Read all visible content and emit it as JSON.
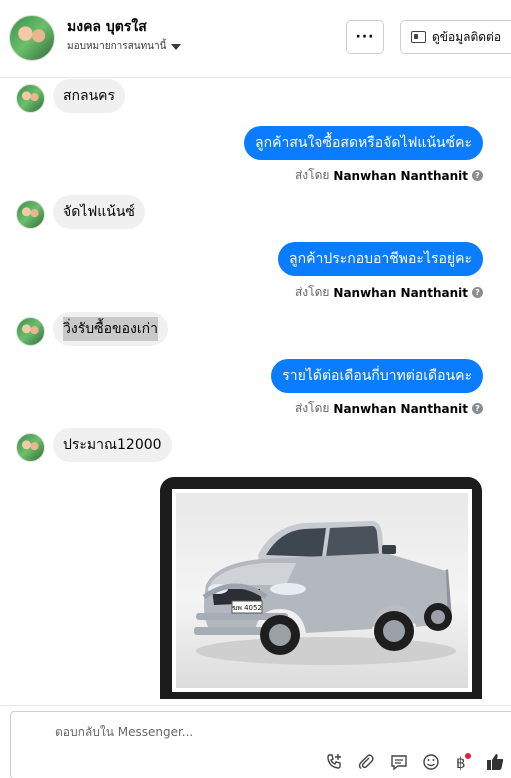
{
  "header": {
    "name": "มงคล บุตรใส",
    "assign_label": "มอบหมายการสนทนานี้",
    "more_label": "···",
    "contact_label": "ดูข้อมูลติดต่อ"
  },
  "messages": [
    {
      "type": "in",
      "text": "สกลนคร"
    },
    {
      "type": "out",
      "text": "ลูกค้าสนใจซื้อสดหรือจัดไฟแน้นซ์คะ",
      "sent_by_prefix": "ส่งโดย",
      "sent_by_name": "Nanwhan Nanthanit"
    },
    {
      "type": "in",
      "text": "จัดไฟแน้นซ์"
    },
    {
      "type": "out",
      "text": "ลูกค้าประกอบอาชีพอะไรอยู่คะ",
      "sent_by_prefix": "ส่งโดย",
      "sent_by_name": "Nanwhan Nanthanit"
    },
    {
      "type": "in",
      "text": "วิ่งรับซื้อของเก่า"
    },
    {
      "type": "out",
      "text": "รายได้ต่อเดือนกี่บาทต่อเดือนคะ",
      "sent_by_prefix": "ส่งโดย",
      "sent_by_name": "Nanwhan Nanthanit"
    },
    {
      "type": "in",
      "text": "ประมาณ12000"
    }
  ],
  "image_card": {
    "plate_text": "ฆพ 4052"
  },
  "composer": {
    "placeholder": "ตอบกลับใน Messenger..."
  },
  "icons": {
    "more": "more-dots-icon",
    "contact": "contact-card-icon",
    "info": "info-icon",
    "tools": [
      "add-call-icon",
      "attach-icon",
      "saved-reply-icon",
      "emoji-icon",
      "payment-icon",
      "like-icon"
    ]
  },
  "colors": {
    "outgoing_bubble": "#0a7cff",
    "incoming_bubble": "#f0f0f0",
    "notification_dot": "#e41e3f"
  }
}
